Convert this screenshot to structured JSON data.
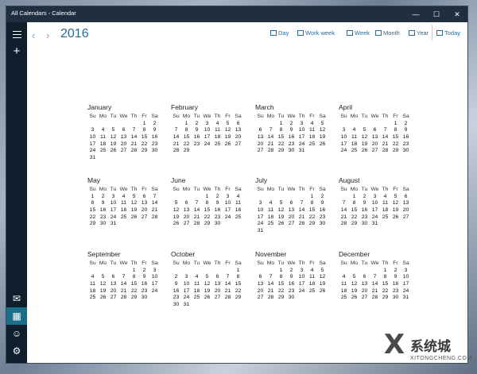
{
  "window": {
    "title": "All Calendars - Calendar"
  },
  "controls": {
    "minimize": "—",
    "maximize": "☐",
    "close": "✕"
  },
  "sidebar": {
    "hamburger": "menu-icon",
    "add": "+",
    "mail": "✉",
    "calendar": "▦",
    "people": "☺",
    "settings": "⚙"
  },
  "header": {
    "prev": "‹",
    "next": "›",
    "year": "2016",
    "views": [
      "Day",
      "Work week",
      "Week",
      "Month",
      "Year",
      "Today"
    ]
  },
  "weekdays": [
    "Su",
    "Mo",
    "Tu",
    "We",
    "Th",
    "Fr",
    "Sa"
  ],
  "months": [
    {
      "name": "January",
      "start": 5,
      "days": 31
    },
    {
      "name": "February",
      "start": 1,
      "days": 29
    },
    {
      "name": "March",
      "start": 2,
      "days": 31
    },
    {
      "name": "April",
      "start": 5,
      "days": 30
    },
    {
      "name": "May",
      "start": 0,
      "days": 31
    },
    {
      "name": "June",
      "start": 3,
      "days": 30
    },
    {
      "name": "July",
      "start": 5,
      "days": 31
    },
    {
      "name": "August",
      "start": 1,
      "days": 31
    },
    {
      "name": "September",
      "start": 4,
      "days": 30
    },
    {
      "name": "October",
      "start": 6,
      "days": 31
    },
    {
      "name": "November",
      "start": 2,
      "days": 30
    },
    {
      "name": "December",
      "start": 4,
      "days": 31
    }
  ],
  "watermark": {
    "mark": "X",
    "text": "系统城",
    "sub": "XITONGCHENG.COM"
  }
}
